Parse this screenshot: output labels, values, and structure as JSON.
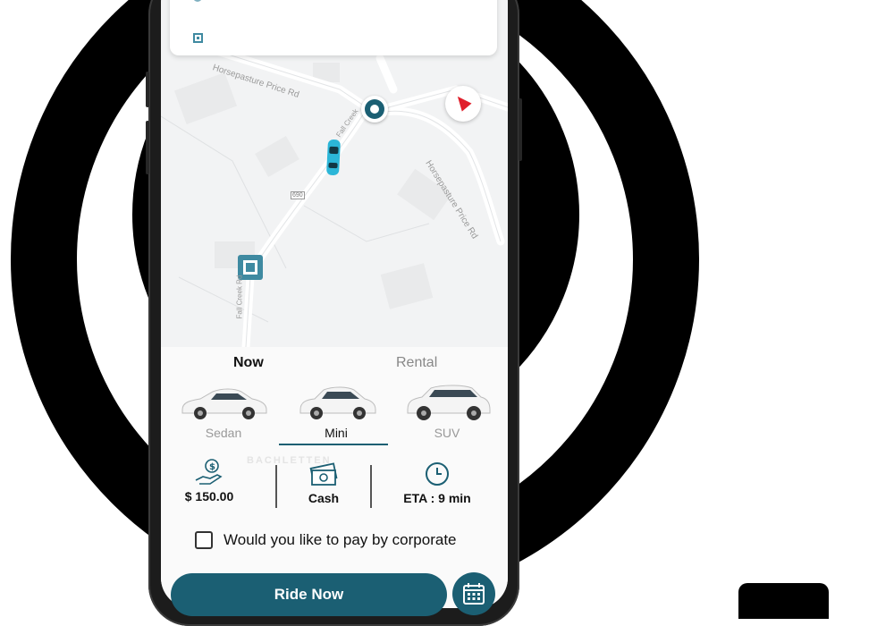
{
  "map": {
    "road_labels": [
      "Horsepasture Price Rd",
      "Horsepasture Price Rd",
      "Fall Creek",
      "Fall Creek Rd",
      "690"
    ],
    "icons": [
      "pickup-location-icon",
      "car-location-icon",
      "drop-location-icon",
      "compass-icon",
      "pickup-dot-icon",
      "drop-square-icon"
    ]
  },
  "tabs": {
    "now": "Now",
    "rental": "Rental"
  },
  "vehicles": [
    {
      "label": "Sedan",
      "selected": false
    },
    {
      "label": "Mini",
      "selected": true
    },
    {
      "label": "SUV",
      "selected": false
    }
  ],
  "watermark": "BACHLETTEN",
  "fare": {
    "amount": "$ 150.00",
    "icon": "money-hand-icon"
  },
  "payment": {
    "method": "Cash",
    "icon": "cash-icon"
  },
  "eta": {
    "text": "ETA : 9 min",
    "icon": "clock-icon"
  },
  "corporate": {
    "label": "Would you like to pay by corporate",
    "checked": false
  },
  "actions": {
    "ride_now": "Ride Now",
    "schedule_icon": "calendar-icon"
  },
  "colors": {
    "primary": "#1b5f73",
    "accent_car": "#2cb6d8",
    "compass_needle": "#e01f2b",
    "background": "#ffffff",
    "rings": "#000000"
  }
}
